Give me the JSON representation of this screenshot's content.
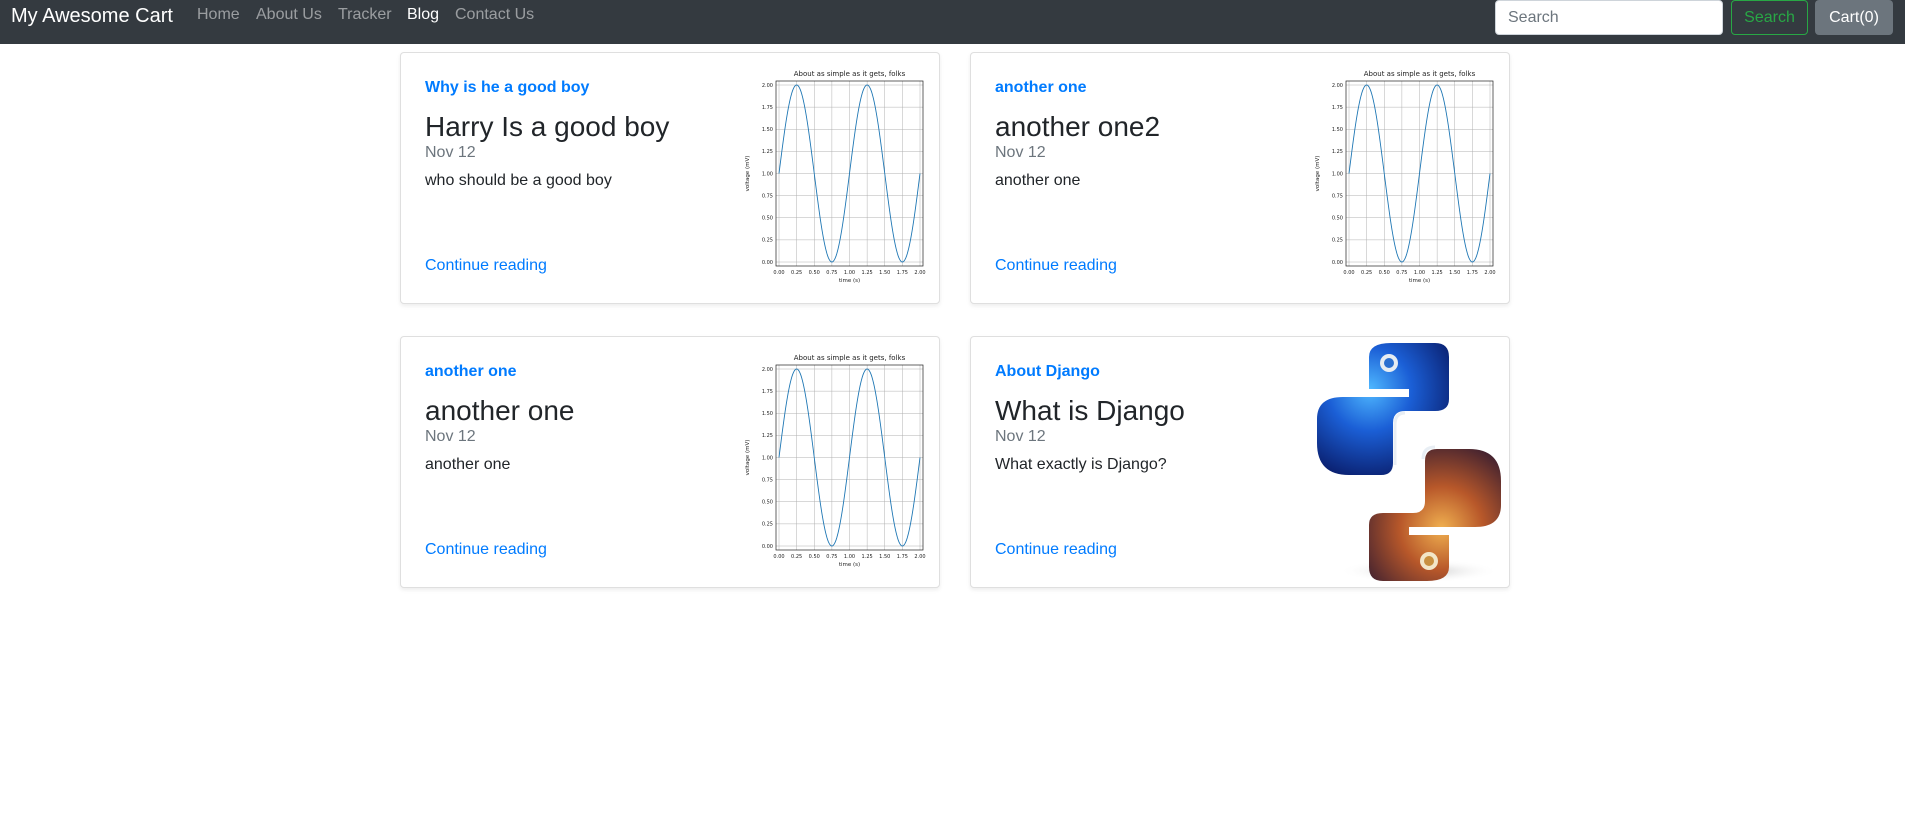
{
  "navbar": {
    "brand": "My Awesome Cart",
    "links": [
      {
        "label": "Home",
        "active": false
      },
      {
        "label": "About Us",
        "active": false
      },
      {
        "label": "Tracker",
        "active": false
      },
      {
        "label": "Blog",
        "active": true
      },
      {
        "label": "Contact Us",
        "active": false
      }
    ],
    "search_placeholder": "Search",
    "search_value": "",
    "search_button": "Search",
    "cart_button": "Cart(0)"
  },
  "colors": {
    "navbar_bg": "#343a40",
    "primary": "#007bff",
    "success": "#28a745",
    "secondary": "#6c757d"
  },
  "posts": [
    {
      "category": "Why is he a good boy",
      "title": "Harry Is a good boy",
      "date": "Nov 12",
      "text": "who should be a good boy",
      "read_more": "Continue reading",
      "thumbnail": "sine-plot"
    },
    {
      "category": "another one",
      "title": "another one2",
      "date": "Nov 12",
      "text": "another one",
      "read_more": "Continue reading",
      "thumbnail": "sine-plot"
    },
    {
      "category": "another one",
      "title": "another one",
      "date": "Nov 12",
      "text": "another one",
      "read_more": "Continue reading",
      "thumbnail": "sine-plot"
    },
    {
      "category": "About Django",
      "title": "What is Django",
      "date": "Nov 12",
      "text": "What exactly is Django?",
      "read_more": "Continue reading",
      "thumbnail": "python-logo"
    }
  ],
  "thumbnail_plot": {
    "title": "About as simple as it gets, folks",
    "xlabel": "time (s)",
    "ylabel": "voltage (mV)",
    "xticks": [
      "0.00",
      "0.25",
      "0.50",
      "0.75",
      "1.00",
      "1.25",
      "1.50",
      "1.75",
      "2.00"
    ],
    "yticks": [
      "0.00",
      "0.25",
      "0.50",
      "0.75",
      "1.00",
      "1.25",
      "1.50",
      "1.75",
      "2.00"
    ],
    "xlim": [
      0,
      2
    ],
    "ylim": [
      0,
      2
    ],
    "function": "1 + sin(2*pi*t)",
    "line_color": "#1f77b4"
  }
}
